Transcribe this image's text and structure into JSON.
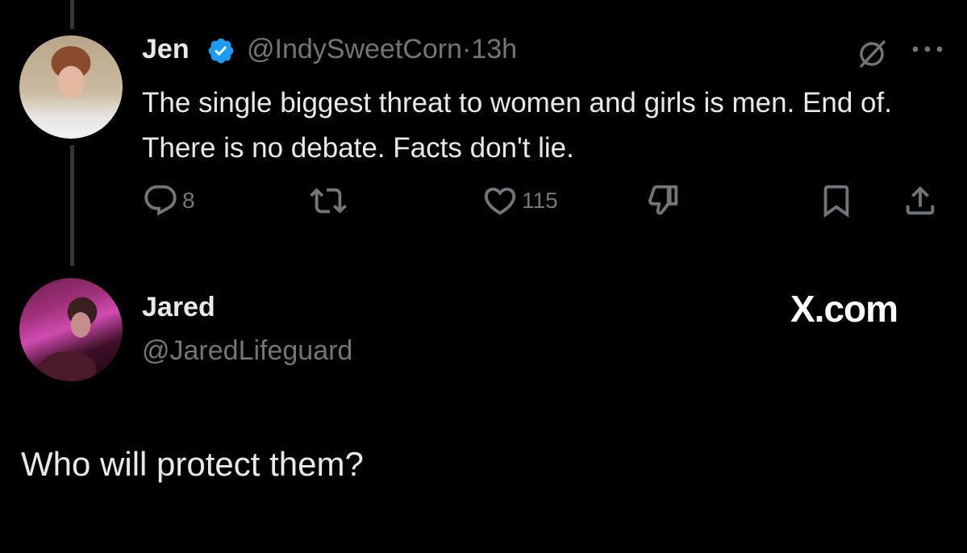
{
  "tweet": {
    "author_name": "Jen",
    "author_handle": "@IndySweetCorn",
    "separator": "·",
    "time": "13h",
    "verified": true,
    "text": "The single biggest threat to women and girls is men. End of. There is no debate. Facts don't lie.",
    "actions": {
      "reply_count": "8",
      "like_count": "115"
    }
  },
  "reply_author": {
    "name": "Jared",
    "handle": "@JaredLifeguard"
  },
  "watermark": "X.com",
  "reply_text": "Who will protect them?",
  "icons": {
    "verified": "verified-badge-icon",
    "grok": "grok-icon",
    "more": "more-dots-icon",
    "reply": "reply-icon",
    "retweet": "retweet-icon",
    "like": "heart-icon",
    "dislike": "thumbs-down-icon",
    "bookmark": "bookmark-icon",
    "share": "share-icon"
  },
  "colors": {
    "background": "#000000",
    "text": "#e7e9ea",
    "secondary": "#71767b",
    "verified": "#1d9bf0",
    "thread_line": "#333639"
  }
}
